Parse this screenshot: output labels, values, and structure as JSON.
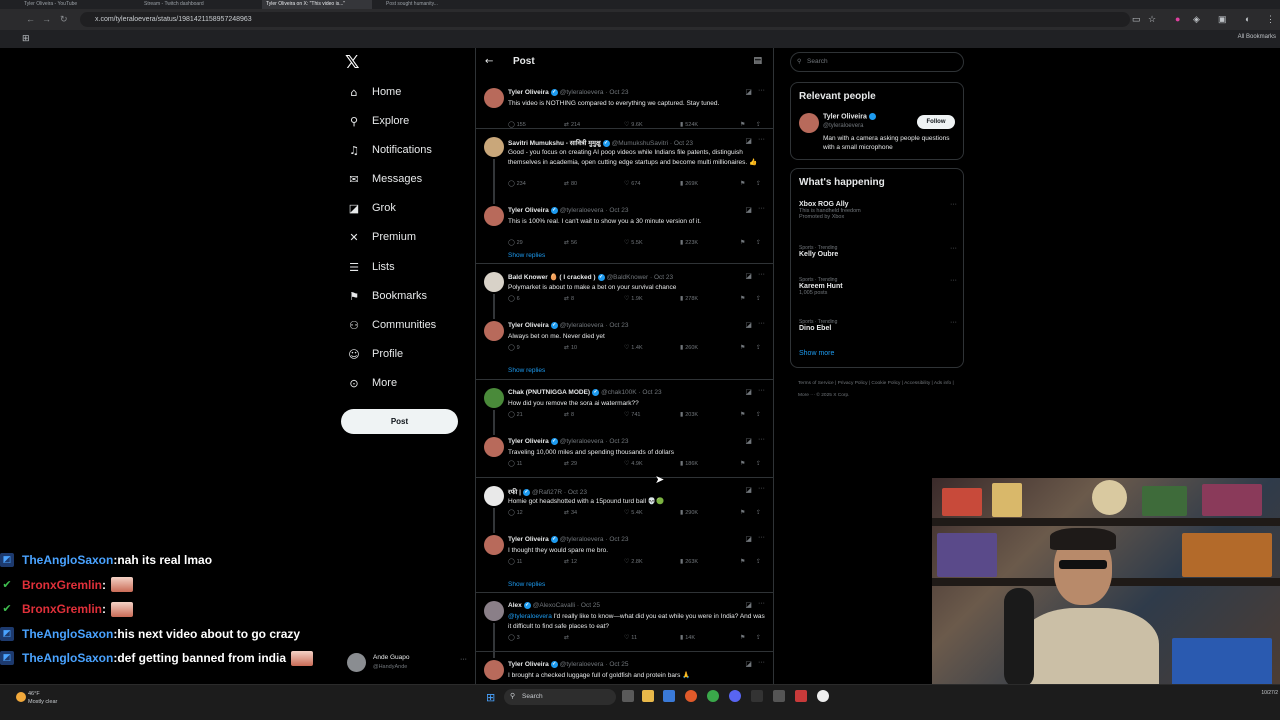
{
  "browser": {
    "tabs": [
      "Tyler Oliveira - YouTube",
      "Stream - Twitch dashboard",
      "Tyler Oliveira on X: \"This video is...\"",
      "Post sought humanity..."
    ],
    "url": "x.com/tyleraloevera/status/1981421158957248963",
    "all_bookmarks": "All Bookmarks"
  },
  "nav": {
    "items": [
      {
        "label": "Home",
        "icon": "home-icon",
        "glyph": "⌂"
      },
      {
        "label": "Explore",
        "icon": "search-icon",
        "glyph": "⚲"
      },
      {
        "label": "Notifications",
        "icon": "bell-icon",
        "glyph": "♫"
      },
      {
        "label": "Messages",
        "icon": "mail-icon",
        "glyph": "✉"
      },
      {
        "label": "Grok",
        "icon": "grok-icon",
        "glyph": "◪"
      },
      {
        "label": "Premium",
        "icon": "x-icon",
        "glyph": "✕"
      },
      {
        "label": "Lists",
        "icon": "list-icon",
        "glyph": "☰"
      },
      {
        "label": "Bookmarks",
        "icon": "bookmark-icon",
        "glyph": "⚑"
      },
      {
        "label": "Communities",
        "icon": "people-icon",
        "glyph": "⚇"
      },
      {
        "label": "Profile",
        "icon": "person-icon",
        "glyph": "☺"
      },
      {
        "label": "More",
        "icon": "more-circle-icon",
        "glyph": "⊙"
      }
    ],
    "post_button": "Post"
  },
  "header": {
    "title": "Post"
  },
  "tweets": [
    {
      "name": "Tyler Oliveira",
      "handle": "@tyleraloevera",
      "date": "Oct 23",
      "text": "This video is NOTHING compared to everything we captured. Stay tuned.",
      "replies": "155",
      "reposts": "214",
      "likes": "9.6K",
      "views": "524K",
      "avatar": "#b86a5b"
    },
    {
      "name": "Savitri Mumukshu - सावित्री मुमुक्षु",
      "handle": "@MumukshuSavitri",
      "date": "Oct 23",
      "text": "Good - you focus on creating AI poop videos while Indians file patents, distinguish themselves in academia, open cutting edge startups and become multi millionaires. 👍",
      "replies": "234",
      "reposts": "80",
      "likes": "674",
      "views": "269K",
      "avatar": "#c9a77a"
    },
    {
      "name": "Tyler Oliveira",
      "handle": "@tyleraloevera",
      "date": "Oct 23",
      "text": "This is 100% real. I can't wait to show you a 30 minute version of it.",
      "replies": "29",
      "reposts": "56",
      "likes": "5.5K",
      "views": "223K",
      "avatar": "#b86a5b"
    },
    {
      "name": "Bald Knower 🥚 ( I cracked )",
      "handle": "@BaldKnower",
      "date": "Oct 23",
      "text": "Polymarket is about to make a bet on your survival chance",
      "replies": "6",
      "reposts": "8",
      "likes": "1.9K",
      "views": "278K",
      "avatar": "#d8d2c8"
    },
    {
      "name": "Tyler Oliveira",
      "handle": "@tyleraloevera",
      "date": "Oct 23",
      "text": "Always bet on me. Never died yet",
      "replies": "9",
      "reposts": "10",
      "likes": "1.4K",
      "views": "260K",
      "avatar": "#b86a5b"
    },
    {
      "name": "Chak (PNUTNIGGA MODE)",
      "handle": "@chak100K",
      "date": "Oct 23",
      "text": "How did you remove the sora ai watermark??",
      "replies": "21",
      "reposts": "8",
      "likes": "741",
      "views": "203K",
      "avatar": "#4a8a3a"
    },
    {
      "name": "Tyler Oliveira",
      "handle": "@tyleraloevera",
      "date": "Oct 23",
      "text": "Traveling 10,000 miles and spending thousands of dollars",
      "replies": "11",
      "reposts": "29",
      "likes": "4.9K",
      "views": "186K",
      "avatar": "#b86a5b"
    },
    {
      "name": "रफी |",
      "handle": "@Rafi27R",
      "date": "Oct 23",
      "text": "Homie got headshotted with a 15pound turd ball 💀🟢",
      "replies": "12",
      "reposts": "34",
      "likes": "5.4K",
      "views": "290K",
      "avatar": "#e9e9e9"
    },
    {
      "name": "Tyler Oliveira",
      "handle": "@tyleraloevera",
      "date": "Oct 23",
      "text": "I thought they would spare me bro.",
      "replies": "11",
      "reposts": "12",
      "likes": "2.8K",
      "views": "263K",
      "avatar": "#b86a5b"
    },
    {
      "name": "Alex",
      "handle": "@AlexoCavalli",
      "date": "Oct 25",
      "mention": "@tyleraloevera",
      "text": " I'd really like to know—what did you eat while you were in India? And was it difficult to find safe places to eat?",
      "replies": "3",
      "reposts": "",
      "likes": "11",
      "views": "14K",
      "avatar": "#8a7f88"
    },
    {
      "name": "Tyler Oliveira",
      "handle": "@tyleraloevera",
      "date": "Oct 25",
      "text": "I brought a checked luggage full of goldfish and protein bars 🙏",
      "replies": "",
      "reposts": "",
      "likes": "",
      "views": "",
      "avatar": "#b86a5b"
    }
  ],
  "show_replies": "Show replies",
  "search": {
    "placeholder": "Search"
  },
  "relevant": {
    "title": "Relevant people",
    "name": "Tyler Oliveira",
    "handle": "@tyleraloevera",
    "bio": "Man with a camera asking people questions with a small microphone",
    "follow": "Follow"
  },
  "happening": {
    "title": "What's happening",
    "trends": [
      {
        "cat": "",
        "name": "Xbox ROG Ally",
        "sub": "This is handheld freedom",
        "extra": "Promoted by Xbox"
      },
      {
        "cat": "Sports · Trending",
        "name": "Kelly Oubre",
        "sub": "",
        "extra": ""
      },
      {
        "cat": "Sports · Trending",
        "name": "Kareem Hunt",
        "sub": "1,005 posts",
        "extra": ""
      },
      {
        "cat": "Sports · Trending",
        "name": "Dino Ebel",
        "sub": "",
        "extra": ""
      }
    ],
    "show_more": "Show more"
  },
  "footer": "Terms of Service  |  Privacy Policy  |  Cookie Policy  |  Accessibility  |  Ads info  |  More ···  © 2025 X Corp.",
  "account": {
    "name": "Ande Guapo",
    "handle": "@HandyAnde"
  },
  "chat": [
    {
      "user": "TheAngloSaxon",
      "color": "#4aa3ff",
      "badge": "prime",
      "msg": "nah its real lmao",
      "emote": false
    },
    {
      "user": "BronxGremlin",
      "color": "#e0303a",
      "badge": "check",
      "msg": "",
      "emote": true
    },
    {
      "user": "BronxGremlin",
      "color": "#e0303a",
      "badge": "check",
      "msg": "",
      "emote": true
    },
    {
      "user": "TheAngloSaxon",
      "color": "#4aa3ff",
      "badge": "prime",
      "msg": "his next video about to go crazy",
      "emote": false
    },
    {
      "user": "TheAngloSaxon",
      "color": "#4aa3ff",
      "badge": "prime",
      "msg": "def getting banned from india",
      "emote": true
    }
  ],
  "taskbar": {
    "temp": "46°F",
    "weather": "Mostly clear",
    "search": "Search",
    "date": "10/27/2"
  }
}
